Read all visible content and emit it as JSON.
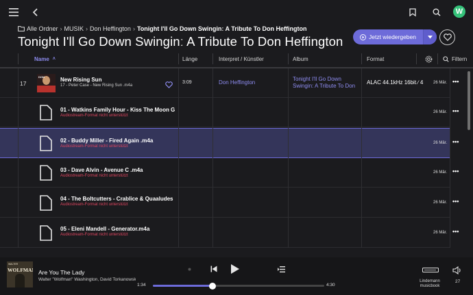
{
  "breadcrumb": {
    "items": [
      "Alle Ordner",
      "MUSIK",
      "Don Heffington"
    ],
    "current": "Tonight I'll Go Down Swinginː A Tribute To Don Heffington"
  },
  "page_title": "Tonight I'll Go Down Swinginː A Tribute To Don Heffington",
  "actions": {
    "play_label": "Jetzt wiedergeben"
  },
  "table": {
    "columns": [
      "Name",
      "Länge",
      "Interpret / Künstler",
      "Album",
      "Format"
    ],
    "sort_indicator": "˄",
    "filter_label": "Filtern",
    "rows": [
      {
        "num": "17",
        "title": "New Rising Sun",
        "sub": "17 - Peter Case   - New Rising Sun  .m4a",
        "duration": "3:09",
        "artist": "Don Heffington",
        "album_line1": "Tonight I'll Go Down",
        "album_line2": "Swingin: A Tribute To Don",
        "format": "ALAC 44.1kHz 16bit ∕ 4",
        "date": "26 Mär.",
        "more": "•••",
        "cover_text": "DON"
      },
      {
        "title": "01 - Watkins Family Hour   - Kiss The Moon G",
        "error": "Audiostream-Format nicht unterstützt",
        "date": "26 Mär.",
        "more": "•••"
      },
      {
        "title": "02 - Buddy Miller   - Fired Again  .m4a",
        "error": "Audiostream-Format nicht unterstützt",
        "date": "26 Mär.",
        "more": "•••"
      },
      {
        "title": "03 - Dave Alvin   - Avenue C  .m4a",
        "error": "Audiostream-Format nicht unterstützt",
        "date": "26 Mär.",
        "more": "•••"
      },
      {
        "title": "04 - The Boltcutters   - Crablice & Quaaludes",
        "error": "Audiostream-Format nicht unterstützt",
        "date": "26 Mär.",
        "more": "•••"
      },
      {
        "title": "05 - Eleni Mandell   - Generator.m4a",
        "error": "Audiostream-Format nicht unterstützt",
        "date": "26 Mär.",
        "more": "•••"
      }
    ]
  },
  "player": {
    "title": "Are You The Lady",
    "artist": "Walter \"Wolfman\" Washington, David Torkanowsky",
    "cover_title": "WOLFMAN",
    "cover_small": "WALTER",
    "elapsed": "1:34",
    "total": "4:30",
    "progress_fraction": 0.348,
    "device_line1": "Lindemann",
    "device_line2": "musicbook",
    "volume": "27"
  },
  "colors": {
    "accent": "#6d6bd9",
    "error": "#e04660",
    "avatar": "#35c27a"
  },
  "avatar_letter": "W"
}
